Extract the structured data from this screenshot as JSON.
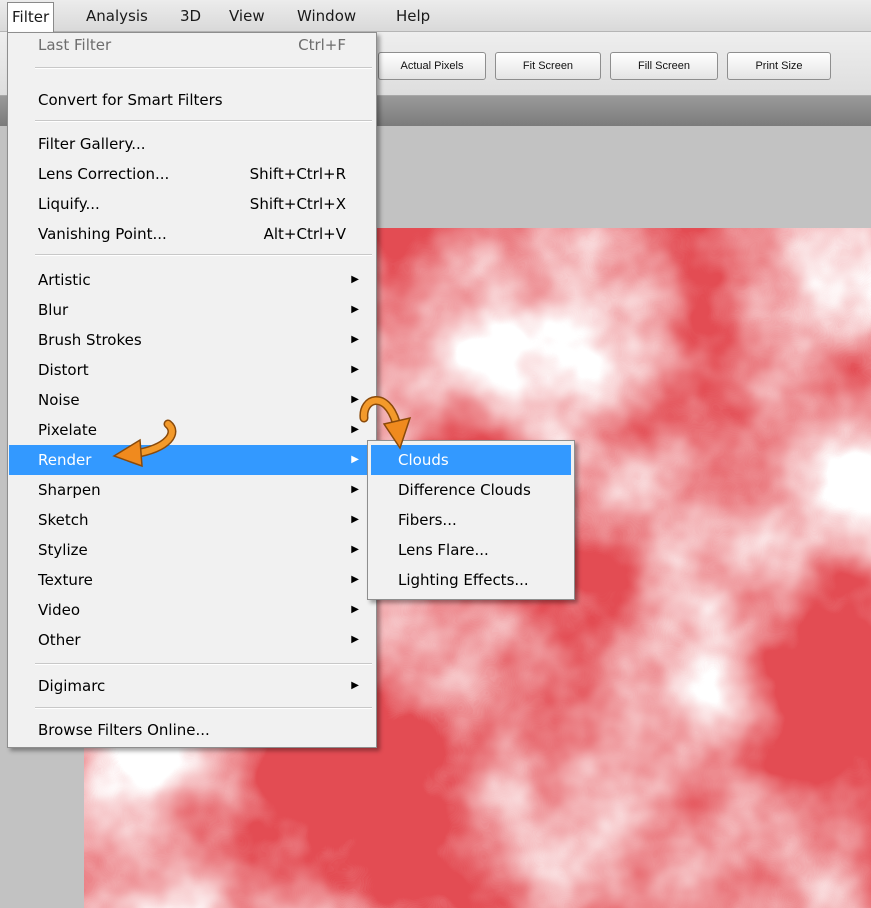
{
  "menubar": {
    "items": [
      {
        "label": "Filter"
      },
      {
        "label": "Analysis"
      },
      {
        "label": "3D"
      },
      {
        "label": "View"
      },
      {
        "label": "Window"
      },
      {
        "label": "Help"
      }
    ]
  },
  "options_bar": {
    "buttons": [
      {
        "label": "Actual Pixels"
      },
      {
        "label": "Fit Screen"
      },
      {
        "label": "Fill Screen"
      },
      {
        "label": "Print Size"
      }
    ]
  },
  "filter_menu": {
    "items": [
      {
        "label": "Last Filter",
        "shortcut": "Ctrl+F"
      },
      {
        "label": "Convert for Smart Filters"
      },
      {
        "label": "Filter Gallery..."
      },
      {
        "label": "Lens Correction...",
        "shortcut": "Shift+Ctrl+R"
      },
      {
        "label": "Liquify...",
        "shortcut": "Shift+Ctrl+X"
      },
      {
        "label": "Vanishing Point...",
        "shortcut": "Alt+Ctrl+V"
      },
      {
        "label": "Artistic"
      },
      {
        "label": "Blur"
      },
      {
        "label": "Brush Strokes"
      },
      {
        "label": "Distort"
      },
      {
        "label": "Noise"
      },
      {
        "label": "Pixelate"
      },
      {
        "label": "Render"
      },
      {
        "label": "Sharpen"
      },
      {
        "label": "Sketch"
      },
      {
        "label": "Stylize"
      },
      {
        "label": "Texture"
      },
      {
        "label": "Video"
      },
      {
        "label": "Other"
      },
      {
        "label": "Digimarc"
      },
      {
        "label": "Browse Filters Online..."
      }
    ],
    "submenu_arrow": "▶"
  },
  "render_submenu": {
    "items": [
      {
        "label": "Clouds"
      },
      {
        "label": "Difference Clouds"
      },
      {
        "label": "Fibers..."
      },
      {
        "label": "Lens Flare..."
      },
      {
        "label": "Lighting Effects..."
      }
    ]
  },
  "colors": {
    "highlight": "#3399ff",
    "cloud_red": "#e34c53",
    "arrow_orange": "#f08a1e"
  },
  "icons": {
    "submenu_arrow": "triangle-right-icon",
    "annotation_arrow": "curved-arrow-icon"
  }
}
